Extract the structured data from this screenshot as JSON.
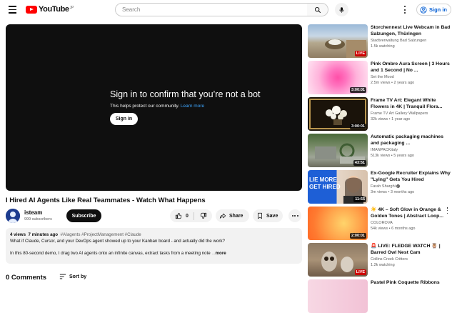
{
  "header": {
    "logo_text": "YouTube",
    "logo_country": "JP",
    "search_placeholder": "Search",
    "signin_label": "Sign in"
  },
  "player": {
    "bot_title": "Sign in to confirm that you’re not a bot",
    "bot_subtitle": "This helps protect our community.",
    "learn_more": "Learn more",
    "signin_button": "Sign in"
  },
  "video": {
    "title": "I Hired AI Agents Like Real Teammates - Watch What Happens",
    "channel": "isteam",
    "subscribers": "999 subscribers",
    "subscribe_label": "Subscribe",
    "likes": "0",
    "share_label": "Share",
    "save_label": "Save"
  },
  "description": {
    "views": "4 views",
    "time": "7 minutes ago",
    "tags": "#AIagents #ProjectManagement #Claude",
    "line1": "What if Claude, Cursor, and your DevOps agent showed up to your Kanban board - and actually did the work?",
    "line2": "In this 80-second demo, I drag two AI agents onto an infinite canvas, extract tasks from a meeting note",
    "line2_fade": " ...",
    "more": "more"
  },
  "comments": {
    "count_label": "0 Comments",
    "sort_label": "Sort by"
  },
  "recommendations": [
    {
      "title": "Storchennest Live Webcam in Bad Salzungen, Thüringen",
      "channel": "Stadtverwaltung Bad Salzungen",
      "stats": "1.5k watching",
      "badge": "LIVE",
      "live": true,
      "verified": false
    },
    {
      "title": "Pink Ombre Aura Screen | 3 Hours and 1 Second | No ...",
      "channel": "Set the Mood",
      "stats": "2.5m views • 2 years ago",
      "badge": "3:00:01",
      "live": false,
      "verified": false
    },
    {
      "title": "Frame TV Art: Elegant White Flowers in 4K | Tranquil Flora...",
      "channel": "Frame TV Art Gallery Wallpapers",
      "stats": "32k views • 1 year ago",
      "badge": "3:00:01",
      "live": false,
      "verified": false
    },
    {
      "title": "Automatic packaging machines and packaging ...",
      "channel": "IMANPACKitaly",
      "stats": "513k views • 5 years ago",
      "badge": "43:51",
      "live": false,
      "verified": false
    },
    {
      "title": "Ex-Google Recruiter Explains Why \"Lying\" Gets You Hired",
      "channel": "Farah Sharghi",
      "stats": "3m views • 3 months ago",
      "badge": "11:55",
      "live": false,
      "verified": true,
      "thumb_text": [
        "LIE MORE",
        "GET HIRED"
      ]
    },
    {
      "title": "☀️ 4K – Soft Glow in Orange & Golden Tones | Abstract Loop...",
      "channel": "COLOROVA",
      "stats": "54k views • 6 months ago",
      "badge": "2:00:01",
      "live": false,
      "verified": false
    },
    {
      "title": "🚨 LIVE: FLEDGE WATCH 🦉 | Barred Owl Nest Cam",
      "channel": "Collins Creek Critters",
      "stats": "1.2k watching",
      "badge": "LIVE",
      "live": true,
      "verified": false
    },
    {
      "title": "Pastel Pink Coquette Ribbons",
      "channel": "",
      "stats": "",
      "badge": "",
      "live": false,
      "verified": false
    }
  ],
  "colors": {
    "brand_red": "#ff0000",
    "link_blue": "#065fd4",
    "live_red": "#cc0000",
    "text_secondary": "#606060"
  },
  "icons": {
    "menu": "hamburger-icon",
    "search": "search-icon",
    "mic": "microphone-icon",
    "settings": "more-vert-icon",
    "account": "account-circle-icon",
    "like": "thumb-up-icon",
    "dislike": "thumb-down-icon",
    "share": "share-icon",
    "save": "save-icon",
    "sort": "sort-icon"
  }
}
